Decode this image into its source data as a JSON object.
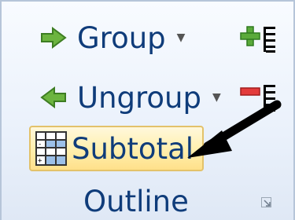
{
  "ribbon_group": {
    "group_label": "Group",
    "ungroup_label": "Ungroup",
    "subtotal_label": "Subtotal",
    "group_name": "Outline"
  },
  "icons": {
    "group": "green-left-arrow-group-icon",
    "ungroup": "green-right-arrow-ungroup-icon",
    "show_detail": "plus-outline-icon",
    "hide_detail": "minus-outline-icon",
    "subtotal": "subtotal-grid-icon",
    "dialog_launcher": "dialog-launcher-icon",
    "annotation": "black-pointer-arrow"
  },
  "colors": {
    "label_text": "#0f3c7a",
    "highlight_fill": "#ffe08a",
    "highlight_border": "#e3c26a",
    "arrow_green": "#5fa83a",
    "minus_red": "#e33b3b"
  }
}
